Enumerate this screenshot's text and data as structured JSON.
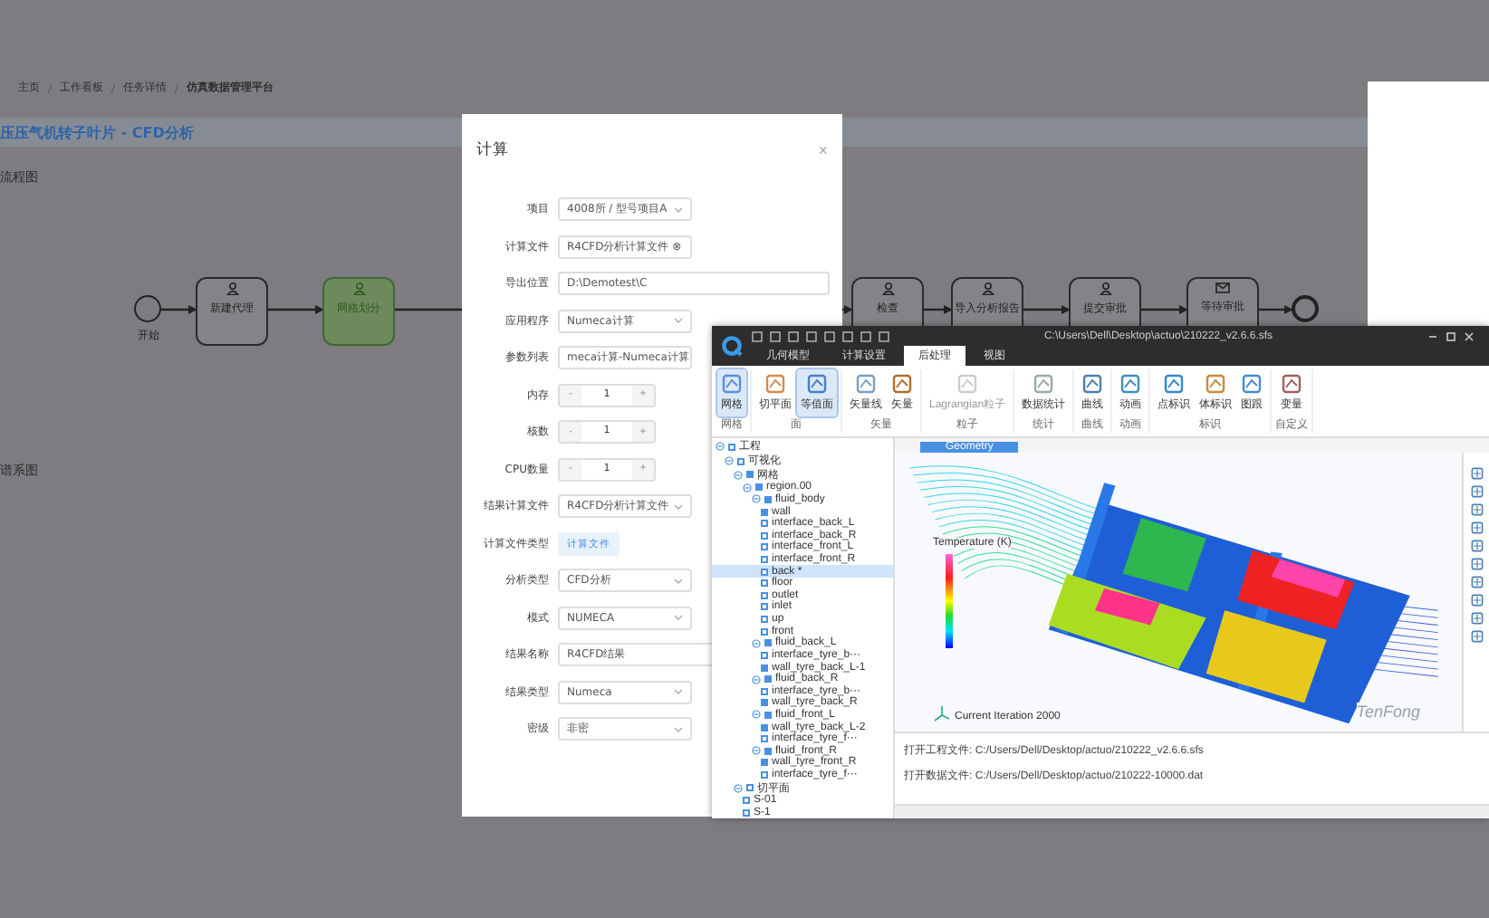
{
  "breadcrumb": [
    {
      "label": "主页",
      "current": false
    },
    {
      "label": "工作看板",
      "current": false
    },
    {
      "label": "任务详情",
      "current": false
    },
    {
      "label": "仿真数据管理平台",
      "current": true
    }
  ],
  "page_title": "压压气机转子叶片 - CFD分析",
  "sections": [
    {
      "title": "流程图"
    },
    {
      "title": "谱系图"
    }
  ],
  "flow": {
    "start": "开始",
    "nodes": [
      {
        "label": "新建代理",
        "kind": "user",
        "selected": false
      },
      {
        "label": "网格划分",
        "kind": "user",
        "selected": true
      },
      {
        "label": "检查",
        "kind": "user",
        "selected": false
      },
      {
        "label": "导入分析报告",
        "kind": "user",
        "selected": false
      },
      {
        "label": "提交审批",
        "kind": "user",
        "selected": false
      },
      {
        "label": "等待审批",
        "kind": "mail",
        "selected": false
      }
    ]
  },
  "dialog": {
    "title": "计算",
    "close": "×",
    "fields": [
      {
        "label": "项目",
        "kind": "select",
        "value": "4008所 / 型号项目A"
      },
      {
        "label": "计算文件",
        "kind": "select",
        "value": "R4CFD分析计算文件 ⊗"
      },
      {
        "label": "导出位置",
        "kind": "input",
        "value": "D:\\Demotest\\C"
      },
      {
        "label": "应用程序",
        "kind": "select",
        "value": "Numeca计算"
      },
      {
        "label": "参数列表",
        "kind": "select",
        "value": "meca计算-Numeca计算"
      },
      {
        "label": "内存",
        "kind": "number",
        "value": "1",
        "minus": "-",
        "plus": "+"
      },
      {
        "label": "核数",
        "kind": "number",
        "value": "1",
        "minus": "-",
        "plus": "+"
      },
      {
        "label": "CPU数量",
        "kind": "number",
        "value": "1",
        "minus": "-",
        "plus": "+"
      },
      {
        "label": "结果计算文件",
        "kind": "select",
        "value": "R4CFD分析计算文件"
      },
      {
        "label": "计算文件类型",
        "kind": "tag",
        "value": "计算文件"
      },
      {
        "label": "分析类型",
        "kind": "select",
        "value": "CFD分析"
      },
      {
        "label": "模式",
        "kind": "select",
        "value": "NUMECA"
      },
      {
        "label": "结果名称",
        "kind": "input",
        "value": "R4CFD结果"
      },
      {
        "label": "结果类型",
        "kind": "select",
        "value": "Numeca"
      },
      {
        "label": "密级",
        "kind": "select",
        "value": "非密"
      }
    ]
  },
  "cfd": {
    "path": "C:\\Users\\Dell\\Desktop\\actuo\\210222_v2.6.6.sfs",
    "tabs": [
      {
        "label": "几何模型",
        "selected": false
      },
      {
        "label": "计算设置",
        "selected": false
      },
      {
        "label": "后处理",
        "selected": true
      },
      {
        "label": "视图",
        "selected": false
      }
    ],
    "ribbon": [
      {
        "label": "网格",
        "buttons": [
          {
            "label": "网格",
            "selected": true,
            "disabled": false
          }
        ]
      },
      {
        "label": "面",
        "buttons": [
          {
            "label": "切平面",
            "selected": false,
            "disabled": false
          },
          {
            "label": "等值面",
            "selected": true,
            "disabled": false
          }
        ]
      },
      {
        "label": "矢量",
        "buttons": [
          {
            "label": "矢量线",
            "selected": false,
            "disabled": false
          },
          {
            "label": "矢量",
            "selected": false,
            "disabled": false
          }
        ]
      },
      {
        "label": "粒子",
        "buttons": [
          {
            "label": "Lagrangian粒子",
            "selected": false,
            "disabled": true
          }
        ]
      },
      {
        "label": "统计",
        "buttons": [
          {
            "label": "数据统计",
            "selected": false,
            "disabled": false
          }
        ]
      },
      {
        "label": "曲线",
        "buttons": [
          {
            "label": "曲线",
            "selected": false,
            "disabled": false
          }
        ]
      },
      {
        "label": "动画",
        "buttons": [
          {
            "label": "动画",
            "selected": false,
            "disabled": false
          }
        ]
      },
      {
        "label": "标识",
        "buttons": [
          {
            "label": "点标识",
            "selected": false,
            "disabled": false
          },
          {
            "label": "体标识",
            "selected": false,
            "disabled": false
          },
          {
            "label": "图跟",
            "selected": false,
            "disabled": false
          }
        ]
      },
      {
        "label": "自定义",
        "buttons": [
          {
            "label": "变量",
            "selected": false,
            "disabled": false
          }
        ]
      }
    ],
    "tree": [
      {
        "label": "工程",
        "checked": false,
        "selected": false,
        "children": [
          {
            "label": "可视化",
            "checked": false,
            "selected": false,
            "children": [
              {
                "label": "网格",
                "checked": true,
                "selected": false,
                "children": [
                  {
                    "label": "region.00",
                    "checked": true,
                    "selected": false,
                    "children": [
                      {
                        "label": "fluid_body",
                        "checked": true,
                        "selected": false,
                        "children": [
                          {
                            "label": "wall",
                            "checked": true,
                            "selected": false
                          },
                          {
                            "label": "interface_back_L",
                            "checked": false,
                            "selected": false
                          },
                          {
                            "label": "interface_back_R",
                            "checked": false,
                            "selected": false
                          },
                          {
                            "label": "interface_front_L",
                            "checked": false,
                            "selected": false
                          },
                          {
                            "label": "interface_front_R",
                            "checked": false,
                            "selected": false
                          },
                          {
                            "label": "back *",
                            "checked": false,
                            "selected": true
                          },
                          {
                            "label": "floor",
                            "checked": false,
                            "selected": false
                          },
                          {
                            "label": "outlet",
                            "checked": false,
                            "selected": false
                          },
                          {
                            "label": "inlet",
                            "checked": false,
                            "selected": false
                          },
                          {
                            "label": "up",
                            "checked": false,
                            "selected": false
                          },
                          {
                            "label": "front",
                            "checked": false,
                            "selected": false
                          }
                        ]
                      },
                      {
                        "label": "fluid_back_L",
                        "checked": true,
                        "selected": false,
                        "children": [
                          {
                            "label": "interface_tyre_b···",
                            "checked": false,
                            "selected": false
                          },
                          {
                            "label": "wall_tyre_back_L-1",
                            "checked": true,
                            "selected": false
                          }
                        ]
                      },
                      {
                        "label": "fluid_back_R",
                        "checked": true,
                        "selected": false,
                        "children": [
                          {
                            "label": "interface_tyre_b···",
                            "checked": false,
                            "selected": false
                          },
                          {
                            "label": "wall_tyre_back_R",
                            "checked": true,
                            "selected": false
                          }
                        ]
                      },
                      {
                        "label": "fluid_front_L",
                        "checked": true,
                        "selected": false,
                        "children": [
                          {
                            "label": "wall_tyre_back_L-2",
                            "checked": true,
                            "selected": false
                          },
                          {
                            "label": "interface_tyre_f···",
                            "checked": false,
                            "selected": false
                          }
                        ]
                      },
                      {
                        "label": "fluid_front_R",
                        "checked": true,
                        "selected": false,
                        "children": [
                          {
                            "label": "wall_tyre_front_R",
                            "checked": true,
                            "selected": false
                          },
                          {
                            "label": "interface_tyre_f···",
                            "checked": false,
                            "selected": false
                          }
                        ]
                      }
                    ]
                  }
                ]
              },
              {
                "label": "切平面",
                "checked": false,
                "selected": false,
                "children": [
                  {
                    "label": "S-01",
                    "checked": false,
                    "selected": false
                  },
                  {
                    "label": "S-1",
                    "checked": false,
                    "selected": false
                  }
                ]
              }
            ]
          }
        ]
      }
    ],
    "viewport_tab": "Geometry",
    "legend_title": "Temperature (K)",
    "iteration": "Current Iteration 2000",
    "watermark": "TenFong",
    "log": [
      "打开工程文件: C:/Users/Dell/Desktop/actuo/210222_v2.6.6.sfs",
      "打开数据文件: C:/Users/Dell/Desktop/actuo/210222-10000.dat"
    ]
  }
}
